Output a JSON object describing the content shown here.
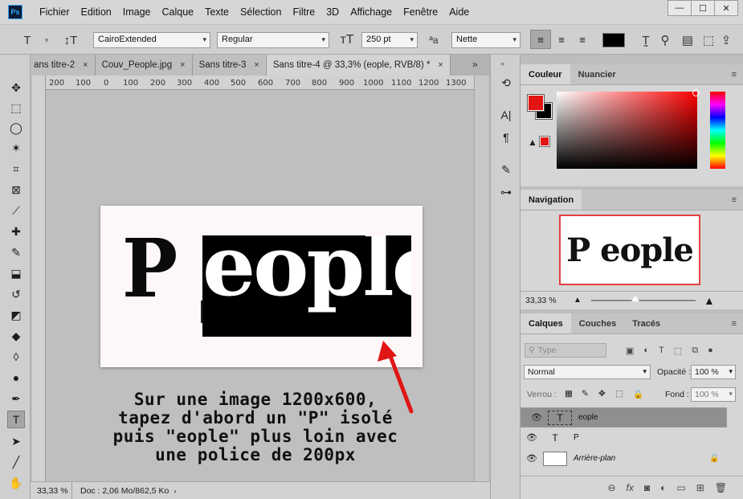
{
  "app": {
    "logo": "Ps"
  },
  "menu": [
    "Fichier",
    "Edition",
    "Image",
    "Calque",
    "Texte",
    "Sélection",
    "Filtre",
    "3D",
    "Affichage",
    "Fenêtre",
    "Aide"
  ],
  "window_buttons": {
    "minimize": "—",
    "maximize": "☐",
    "close": "✕"
  },
  "options": {
    "font_family": "CairoExtended",
    "font_style": "Regular",
    "font_size": "250 pt",
    "aa_label": "ªa",
    "antialias": "Nette",
    "text_color": "#000000"
  },
  "tabs": [
    {
      "label": "ans titre-2",
      "close": "×"
    },
    {
      "label": "Couv_People.jpg",
      "close": "×"
    },
    {
      "label": "Sans titre-3",
      "close": "×"
    },
    {
      "label": "Sans titre-4 @ 33,3% (eople, RVB/8) *",
      "close": "×"
    }
  ],
  "ruler_ticks": [
    "200",
    "100",
    "0",
    "100",
    "200",
    "300",
    "400",
    "500",
    "600",
    "700",
    "800",
    "900",
    "1000",
    "1100",
    "1200",
    "1300"
  ],
  "canvas": {
    "letter_p": "P",
    "eople": "eople",
    "eople_bg": "#000000"
  },
  "annotation": [
    "Sur une image 1200x600,",
    "tapez d'abord un \"P\" isolé",
    "puis \"eople\" plus loin avec",
    "une police de 200px"
  ],
  "status": {
    "zoom": "33,33 %",
    "doc": "Doc : 2,06 Mo/862,5 Ko"
  },
  "panels": {
    "color": {
      "tabs": [
        "Couleur",
        "Nuancier"
      ],
      "foreground": "#e31414",
      "background": "#000000"
    },
    "navigation": {
      "title": "Navigation",
      "preview_text": "P eople",
      "zoom": "33,33 %"
    },
    "layers": {
      "tabs": [
        "Calques",
        "Couches",
        "Tracés"
      ],
      "search_placeholder": "Type",
      "blend_mode": "Normal",
      "opacity_label": "Opacité :",
      "opacity": "100 %",
      "lock_label": "Verrou :",
      "fill_label": "Fond :",
      "fill": "100 %",
      "items": [
        {
          "name": "eople",
          "type": "text",
          "selected": true
        },
        {
          "name": "P",
          "type": "text",
          "selected": false
        },
        {
          "name": "Arrière-plan",
          "type": "background",
          "selected": false
        }
      ]
    }
  }
}
